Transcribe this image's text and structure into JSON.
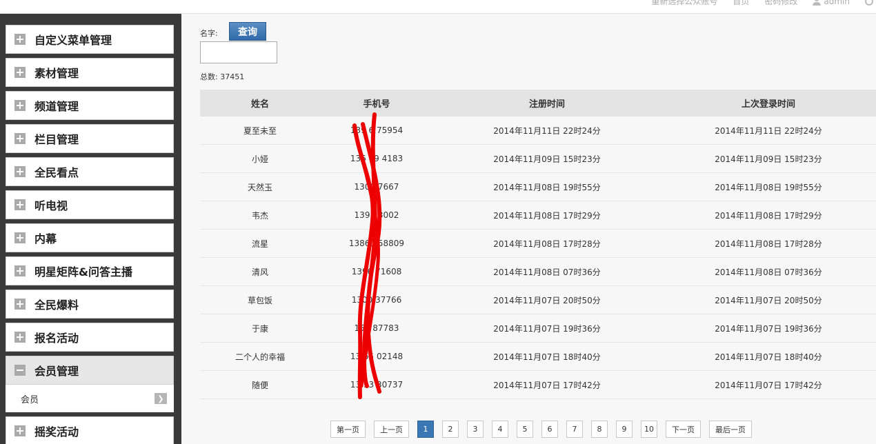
{
  "top_links": [
    "重新选择公众账号",
    "首页",
    "密码修改",
    "admin"
  ],
  "sidebar": {
    "items": [
      {
        "label": "自定义菜单管理",
        "state": "collapsed"
      },
      {
        "label": "素材管理",
        "state": "collapsed"
      },
      {
        "label": "频道管理",
        "state": "collapsed"
      },
      {
        "label": "栏目管理",
        "state": "collapsed"
      },
      {
        "label": "全民看点",
        "state": "collapsed"
      },
      {
        "label": "听电视",
        "state": "collapsed"
      },
      {
        "label": "内幕",
        "state": "collapsed"
      },
      {
        "label": "明星矩阵&问答主播",
        "state": "collapsed"
      },
      {
        "label": "全民爆料",
        "state": "collapsed"
      },
      {
        "label": "报名活动",
        "state": "collapsed"
      },
      {
        "label": "会员管理",
        "state": "expanded"
      },
      {
        "label": "摇奖活动",
        "state": "collapsed"
      }
    ],
    "sub_item": "会员"
  },
  "search": {
    "label": "名字:",
    "button": "查询",
    "input_value": "",
    "total_label": "总数:",
    "total_value": "37451"
  },
  "table": {
    "headers": [
      "姓名",
      "手机号",
      "注册时间",
      "上次登录时间"
    ],
    "rows": [
      [
        "夏至未至",
        "139  6 75954",
        "2014年11月11日  22时24分",
        "2014年11月11日  22时24分"
      ],
      [
        "小娅",
        "136  79  4183",
        "2014年11月09日  15时23分",
        "2014年11月09日  15时23分"
      ],
      [
        "天然玉",
        "1300    7667",
        "2014年11月08日  19时55分",
        "2014年11月08日  19时55分"
      ],
      [
        "韦杰",
        "1392    3002",
        "2014年11月08日  17时29分",
        "2014年11月08日  17时29分"
      ],
      [
        "流星",
        "13861  58809",
        "2014年11月08日  17时28分",
        "2014年11月08日  17时28分"
      ],
      [
        "清风",
        "1396   71608",
        "2014年11月08日  07时36分",
        "2014年11月08日  07时36分"
      ],
      [
        "草包饭",
        "1300    37766",
        "2014年11月07日  20时50分",
        "2014年11月07日  20时50分"
      ],
      [
        "于康",
        "153   87783",
        "2014年11月07日  19时36分",
        "2014年11月07日  19时36分"
      ],
      [
        "二个人的幸福",
        "13   65  02148",
        "2014年11月07日  18时40分",
        "2014年11月07日  18时40分"
      ],
      [
        "随便",
        "13  93  30737",
        "2014年11月07日  17时42分",
        "2014年11月07日  17时42分"
      ]
    ]
  },
  "pagination": {
    "first": "第一页",
    "prev": "上一页",
    "pages": [
      "1",
      "2",
      "3",
      "4",
      "5",
      "6",
      "7",
      "8",
      "9",
      "10"
    ],
    "current": "1",
    "next": "下一页",
    "last": "最后一页"
  },
  "colors": {
    "sidebar_bg": "#3a3a3a",
    "query_button": "#3a77b4",
    "scribble": "#ee0000"
  }
}
